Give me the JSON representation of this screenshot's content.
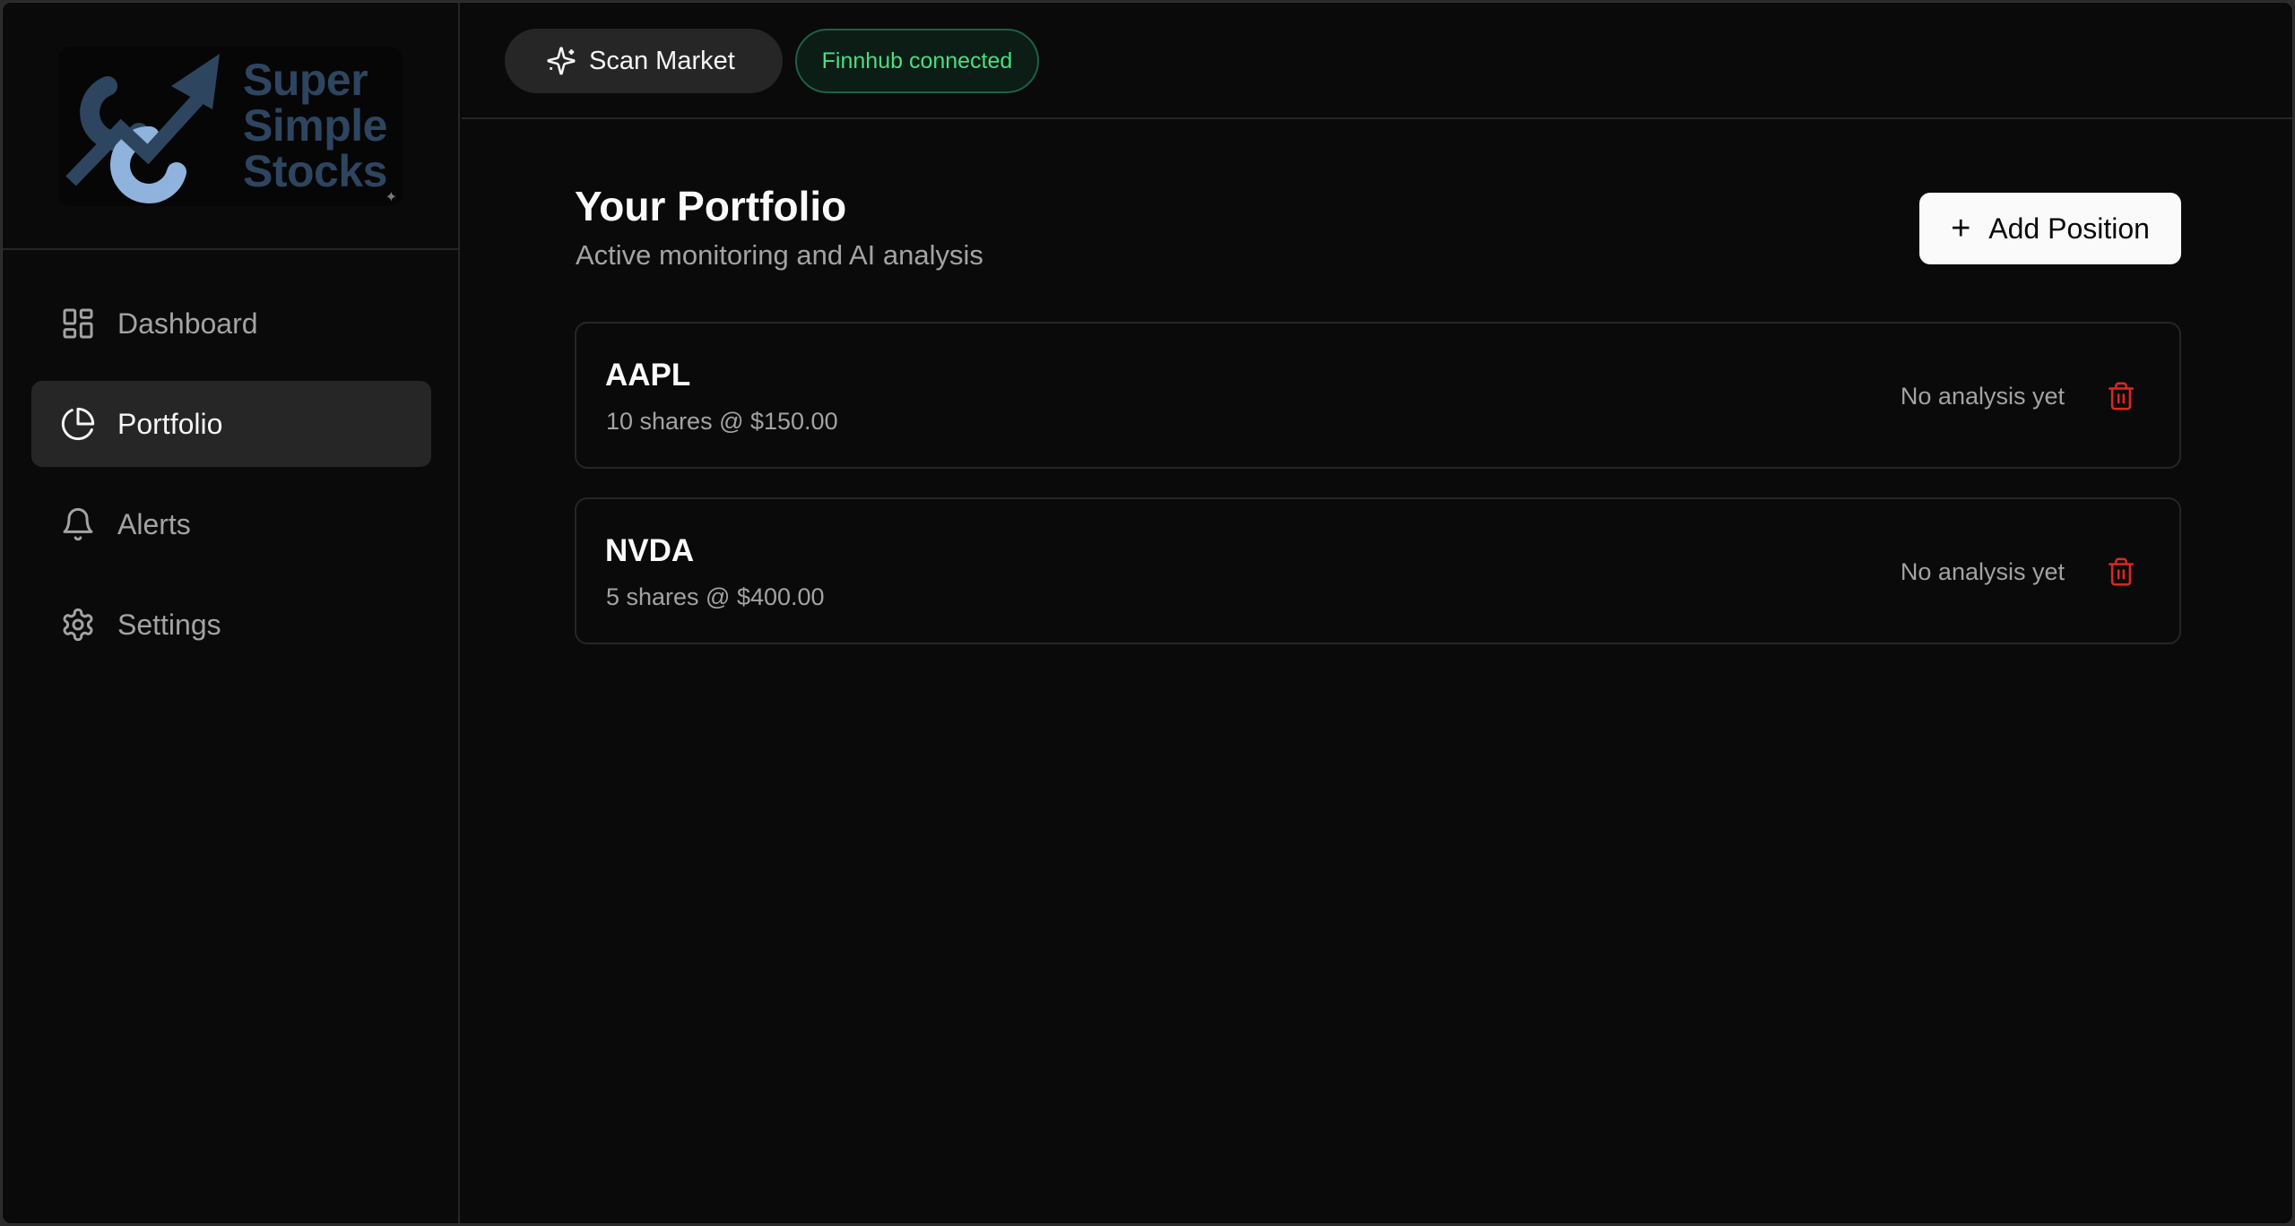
{
  "app": {
    "logo_text": [
      "Super",
      "Simple",
      "Stocks"
    ]
  },
  "sidebar": {
    "items": [
      {
        "label": "Dashboard",
        "icon": "layout-grid-icon",
        "active": false
      },
      {
        "label": "Portfolio",
        "icon": "pie-chart-icon",
        "active": true
      },
      {
        "label": "Alerts",
        "icon": "bell-icon",
        "active": false
      },
      {
        "label": "Settings",
        "icon": "gear-icon",
        "active": false
      }
    ]
  },
  "topbar": {
    "scan_label": "Scan Market",
    "scan_icon": "sparkles-icon",
    "status_label": "Finnhub connected",
    "status_color": "#4ade80"
  },
  "main": {
    "title": "Your Portfolio",
    "subtitle": "Active monitoring and AI analysis",
    "add_label": "Add Position",
    "positions": [
      {
        "ticker": "AAPL",
        "details": "10 shares @ $150.00",
        "analysis": "No analysis yet"
      },
      {
        "ticker": "NVDA",
        "details": "5 shares @ $400.00",
        "analysis": "No analysis yet"
      }
    ]
  },
  "colors": {
    "background": "#0a0a0a",
    "accent_danger": "#dc2626",
    "logo_primary": "#2e4560",
    "logo_secondary": "#8fb3dc"
  }
}
